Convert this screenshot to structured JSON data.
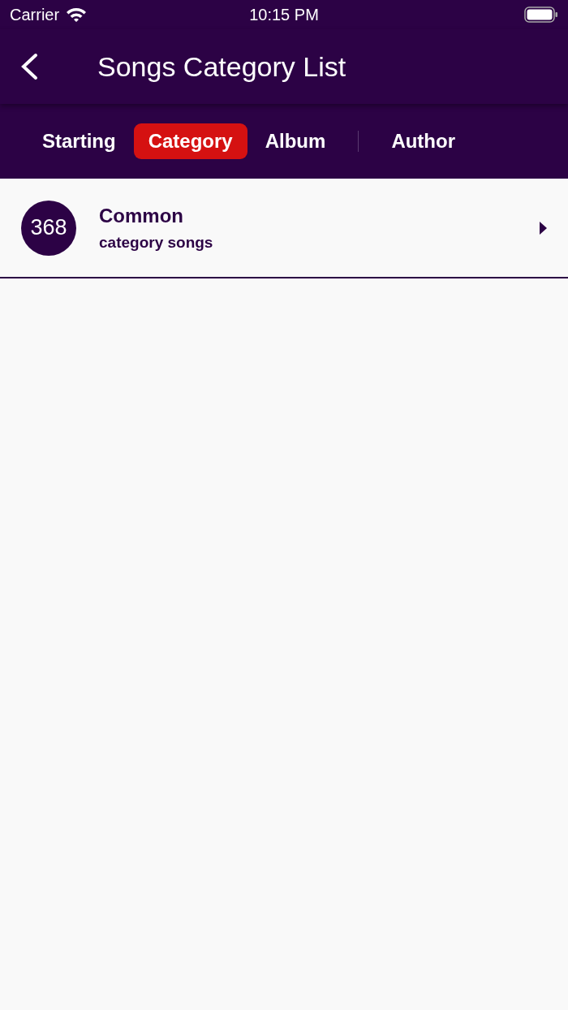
{
  "status_bar": {
    "carrier": "Carrier",
    "time": "10:15 PM"
  },
  "header": {
    "title": "Songs Category List"
  },
  "tabs": [
    {
      "label": "Starting",
      "selected": false,
      "separator_before": false
    },
    {
      "label": "Category",
      "selected": true,
      "separator_before": false
    },
    {
      "label": "Album",
      "selected": false,
      "separator_before": false
    },
    {
      "label": "Author",
      "selected": false,
      "separator_before": true
    }
  ],
  "items": [
    {
      "count": "368",
      "title": "Common",
      "subtitle": "category songs"
    }
  ]
}
